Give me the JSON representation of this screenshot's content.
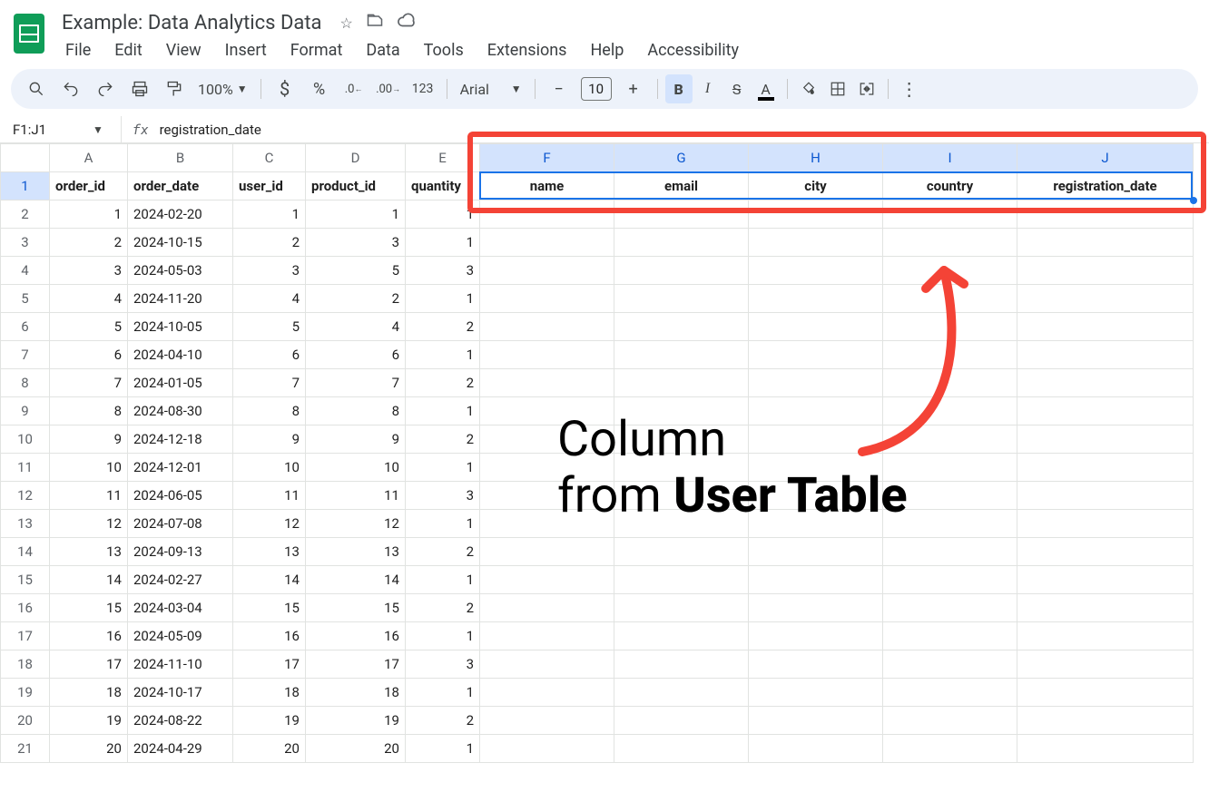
{
  "doc": {
    "title": "Example: Data Analytics Data"
  },
  "menus": [
    "File",
    "Edit",
    "View",
    "Insert",
    "Format",
    "Data",
    "Tools",
    "Extensions",
    "Help",
    "Accessibility"
  ],
  "toolbar": {
    "zoom": "100%",
    "font": "Arial",
    "font_size": "10"
  },
  "namebox": "F1:J1",
  "formula": "registration_date",
  "columns": [
    "A",
    "B",
    "C",
    "D",
    "E",
    "F",
    "G",
    "H",
    "I",
    "J"
  ],
  "selected_cols": [
    "F",
    "G",
    "H",
    "I",
    "J"
  ],
  "headers": {
    "A": "order_id",
    "B": "order_date",
    "C": "user_id",
    "D": "product_id",
    "E": "quantity",
    "F": "name",
    "G": "email",
    "H": "city",
    "I": "country",
    "J": "registration_date"
  },
  "rows": [
    {
      "n": 1,
      "A": "1",
      "B": "2024-02-20",
      "C": "1",
      "D": "1",
      "E": "1"
    },
    {
      "n": 2,
      "A": "2",
      "B": "2024-10-15",
      "C": "2",
      "D": "3",
      "E": "1"
    },
    {
      "n": 3,
      "A": "3",
      "B": "2024-05-03",
      "C": "3",
      "D": "5",
      "E": "3"
    },
    {
      "n": 4,
      "A": "4",
      "B": "2024-11-20",
      "C": "4",
      "D": "2",
      "E": "1"
    },
    {
      "n": 5,
      "A": "5",
      "B": "2024-10-05",
      "C": "5",
      "D": "4",
      "E": "2"
    },
    {
      "n": 6,
      "A": "6",
      "B": "2024-04-10",
      "C": "6",
      "D": "6",
      "E": "1"
    },
    {
      "n": 7,
      "A": "7",
      "B": "2024-01-05",
      "C": "7",
      "D": "7",
      "E": "2"
    },
    {
      "n": 8,
      "A": "8",
      "B": "2024-08-30",
      "C": "8",
      "D": "8",
      "E": "1"
    },
    {
      "n": 9,
      "A": "9",
      "B": "2024-12-18",
      "C": "9",
      "D": "9",
      "E": "2"
    },
    {
      "n": 10,
      "A": "10",
      "B": "2024-12-01",
      "C": "10",
      "D": "10",
      "E": "1"
    },
    {
      "n": 11,
      "A": "11",
      "B": "2024-06-05",
      "C": "11",
      "D": "11",
      "E": "3"
    },
    {
      "n": 12,
      "A": "12",
      "B": "2024-07-08",
      "C": "12",
      "D": "12",
      "E": "1"
    },
    {
      "n": 13,
      "A": "13",
      "B": "2024-09-13",
      "C": "13",
      "D": "13",
      "E": "2"
    },
    {
      "n": 14,
      "A": "14",
      "B": "2024-02-27",
      "C": "14",
      "D": "14",
      "E": "1"
    },
    {
      "n": 15,
      "A": "15",
      "B": "2024-03-04",
      "C": "15",
      "D": "15",
      "E": "2"
    },
    {
      "n": 16,
      "A": "16",
      "B": "2024-05-09",
      "C": "16",
      "D": "16",
      "E": "1"
    },
    {
      "n": 17,
      "A": "17",
      "B": "2024-11-10",
      "C": "17",
      "D": "17",
      "E": "3"
    },
    {
      "n": 18,
      "A": "18",
      "B": "2024-10-17",
      "C": "18",
      "D": "18",
      "E": "1"
    },
    {
      "n": 19,
      "A": "19",
      "B": "2024-08-22",
      "C": "19",
      "D": "19",
      "E": "2"
    },
    {
      "n": 20,
      "A": "20",
      "B": "2024-04-29",
      "C": "20",
      "D": "20",
      "E": "1"
    }
  ],
  "annotation": {
    "line1": "Column",
    "line2_a": "from ",
    "line2_b": "User Table"
  }
}
